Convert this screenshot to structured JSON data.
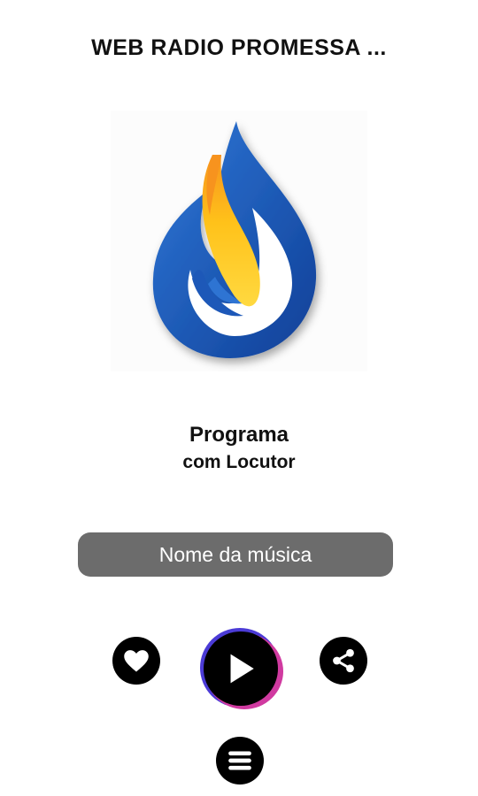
{
  "header": {
    "title": "WEB RADIO PROMESSA ..."
  },
  "logo": {
    "icon": "flame-drop-logo-icon",
    "colors": {
      "blue": "#1f56b8",
      "yellow": "#ffd21f",
      "orange": "#f7931e"
    }
  },
  "now_playing": {
    "program": "Programa",
    "presenter": "com Locutor",
    "song": "Nome da música"
  },
  "controls": {
    "like_icon": "heart-icon",
    "play_icon": "play-icon",
    "share_icon": "share-icon",
    "menu_icon": "menu-icon",
    "play_ring_colors": [
      "#4b3bd6",
      "#d03aa0"
    ]
  }
}
